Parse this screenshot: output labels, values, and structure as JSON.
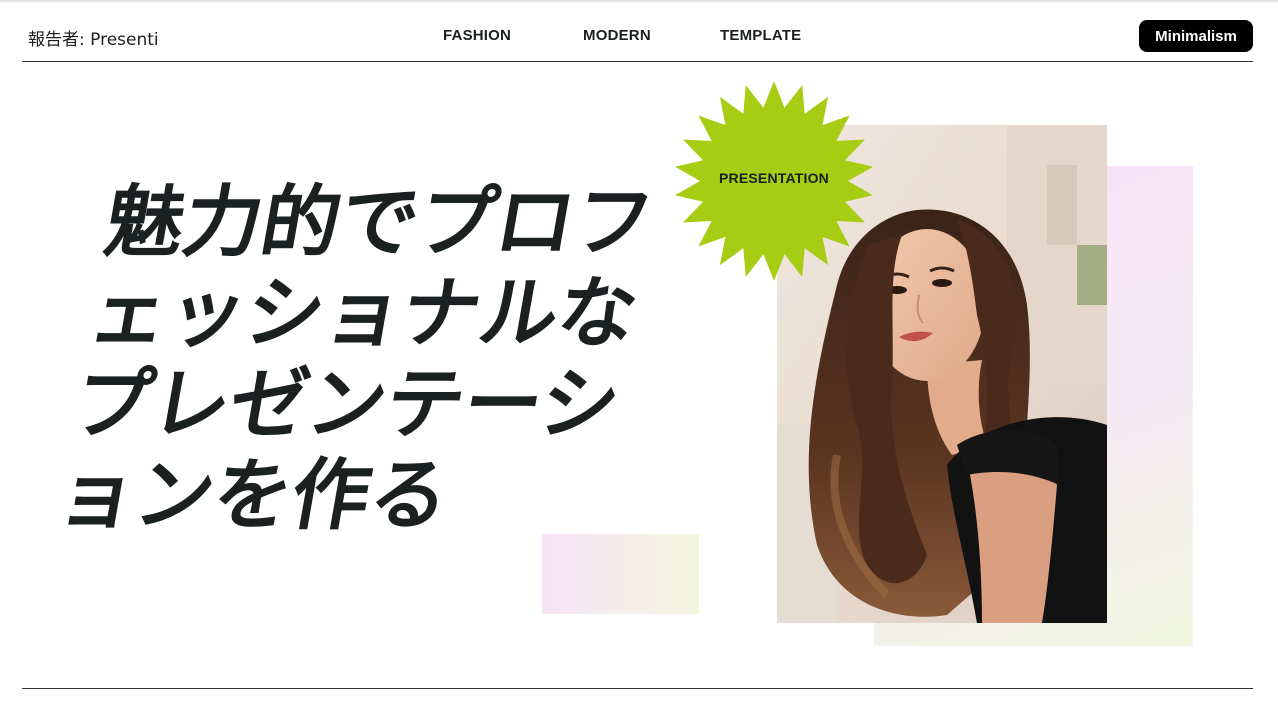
{
  "header": {
    "reporter": "報告者: Presenti",
    "nav": [
      "FASHION",
      "MODERN",
      "TEMPLATE"
    ],
    "badge": "Minimalism"
  },
  "hero": {
    "headline_lines": [
      "魅力的でプロフ",
      "ェッショナルな",
      "プレゼンテーシ",
      "ョンを作る"
    ],
    "sticker_label": "PRESENTATION"
  },
  "colors": {
    "accent_green": "#a6cc14",
    "text": "#1b2021",
    "badge_bg": "#000000",
    "pink_tint": "#f8e0f8",
    "green_tint": "#f0f6df"
  },
  "images": {
    "hero_photo": "portrait of woman with long wavy brown hair in black t-shirt, building background"
  }
}
